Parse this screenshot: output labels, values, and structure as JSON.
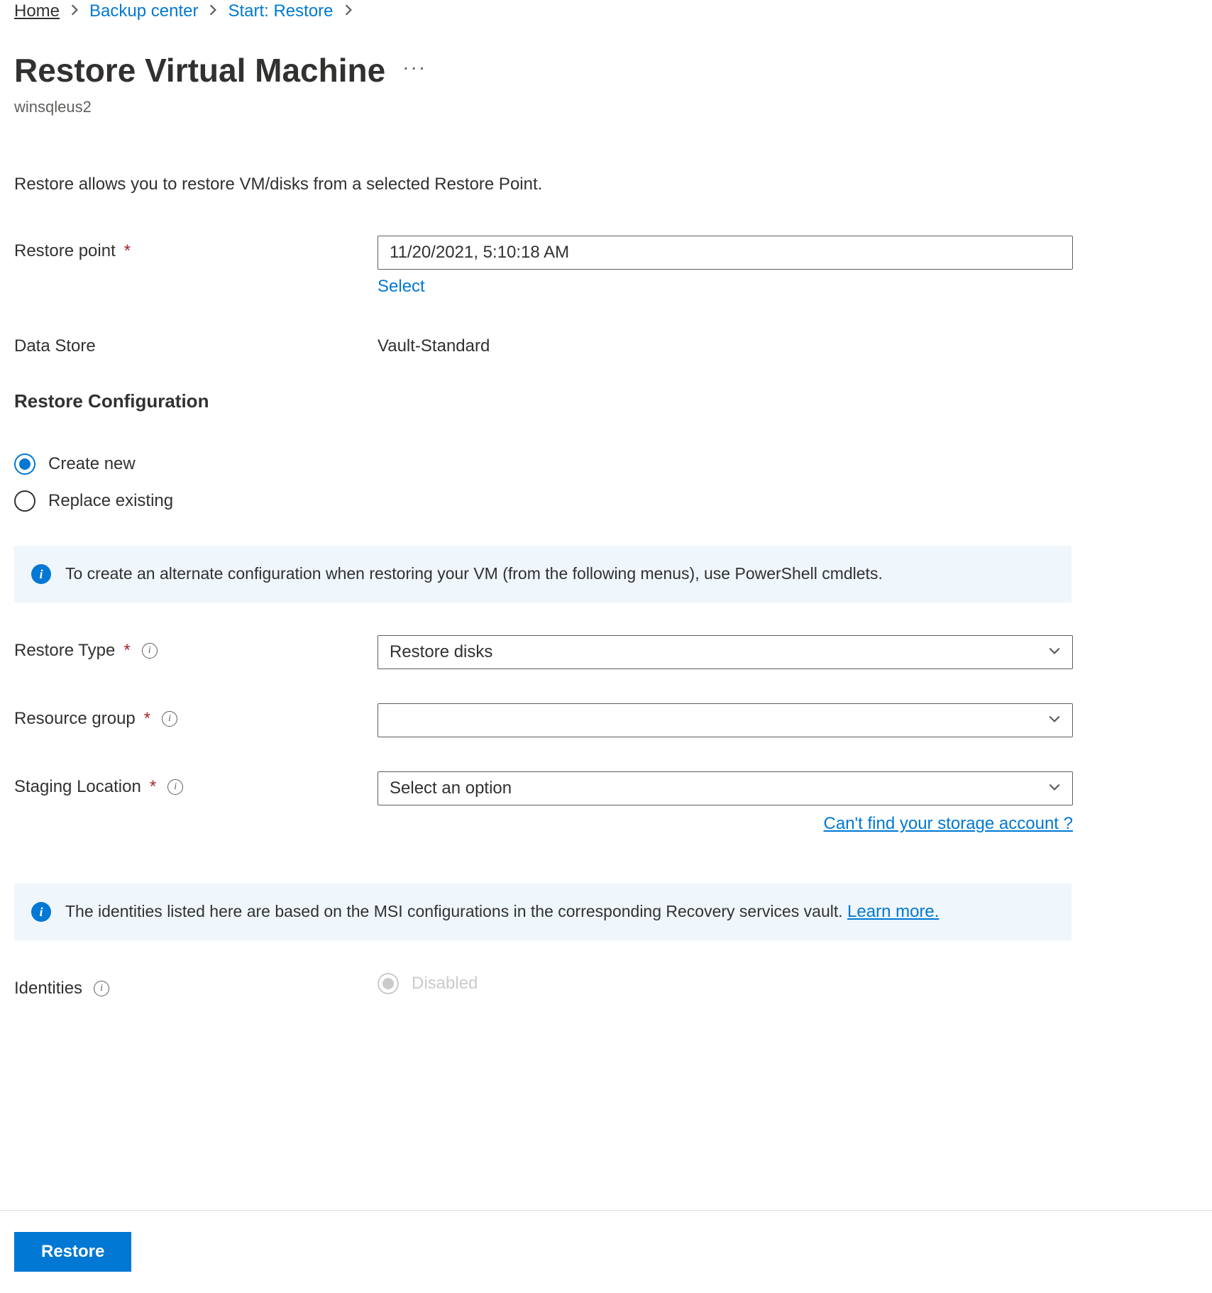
{
  "breadcrumb": {
    "home": "Home",
    "backup_center": "Backup center",
    "start_restore": "Start: Restore"
  },
  "header": {
    "title": "Restore Virtual Machine",
    "subtitle": "winsqleus2"
  },
  "intro": "Restore allows you to restore VM/disks from a selected Restore Point.",
  "fields": {
    "restore_point_label": "Restore point",
    "restore_point_value": "11/20/2021, 5:10:18 AM",
    "select_link": "Select",
    "data_store_label": "Data Store",
    "data_store_value": "Vault-Standard",
    "restore_type_label": "Restore Type",
    "restore_type_value": "Restore disks",
    "resource_group_label": "Resource group",
    "resource_group_value": "",
    "staging_location_label": "Staging Location",
    "staging_location_placeholder": "Select an option",
    "storage_link": "Can't find your storage account ?",
    "identities_label": "Identities",
    "identities_value": "Disabled"
  },
  "section": {
    "restore_config": "Restore Configuration"
  },
  "radios": {
    "create_new": "Create new",
    "replace_existing": "Replace existing"
  },
  "banners": {
    "alt_config": "To create an alternate configuration when restoring your VM (from the following menus), use PowerShell cmdlets.",
    "identities": "The identities listed here are based on the MSI configurations in the corresponding Recovery services vault. ",
    "learn_more": "Learn more."
  },
  "footer": {
    "restore_btn": "Restore"
  }
}
